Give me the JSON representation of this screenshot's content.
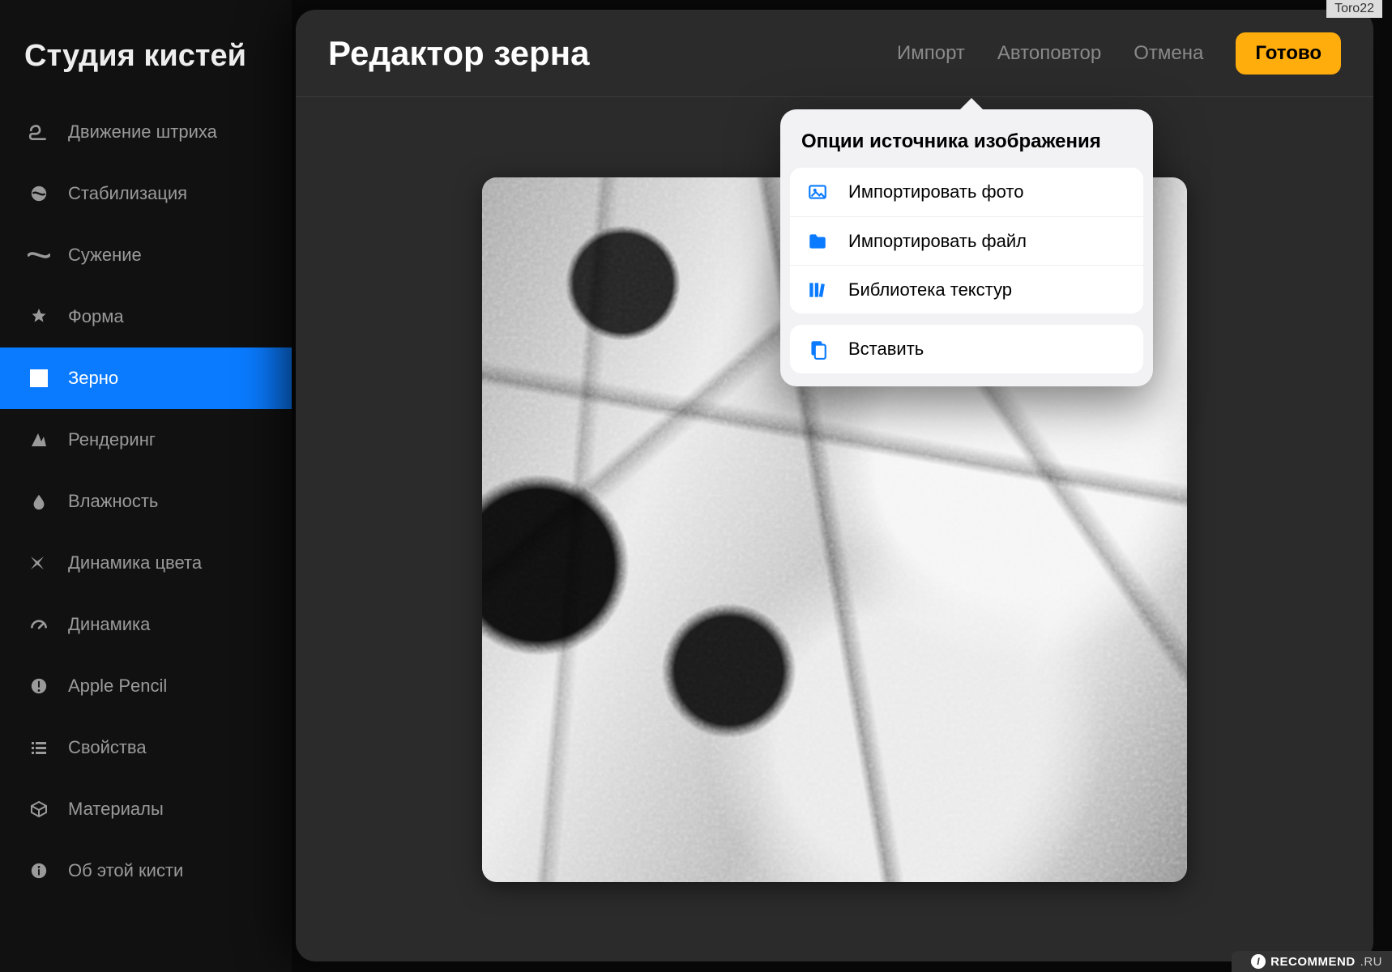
{
  "sidebar": {
    "title": "Студия кистей",
    "items": [
      {
        "label": "Движение штриха",
        "icon": "stroke-path-icon"
      },
      {
        "label": "Стабилизация",
        "icon": "stabilization-icon"
      },
      {
        "label": "Сужение",
        "icon": "taper-icon"
      },
      {
        "label": "Форма",
        "icon": "shape-icon"
      },
      {
        "label": "Зерно",
        "icon": "grain-icon",
        "selected": true
      },
      {
        "label": "Рендеринг",
        "icon": "rendering-icon"
      },
      {
        "label": "Влажность",
        "icon": "wetness-icon"
      },
      {
        "label": "Динамика цвета",
        "icon": "color-dynamics-icon"
      },
      {
        "label": "Динамика",
        "icon": "dynamics-icon"
      },
      {
        "label": "Apple Pencil",
        "icon": "apple-pencil-icon"
      },
      {
        "label": "Свойства",
        "icon": "properties-icon"
      },
      {
        "label": "Материалы",
        "icon": "materials-icon"
      },
      {
        "label": "Об этой кисти",
        "icon": "about-icon"
      }
    ]
  },
  "editor": {
    "title": "Редактор зерна",
    "import_label": "Импорт",
    "autorepeat_label": "Автоповтор",
    "cancel_label": "Отмена",
    "done_label": "Готово"
  },
  "popover": {
    "title": "Опции источника изображения",
    "items": [
      {
        "label": "Импортировать фото",
        "icon": "photo-icon"
      },
      {
        "label": "Импортировать файл",
        "icon": "folder-icon"
      },
      {
        "label": "Библиотека текстур",
        "icon": "library-icon"
      },
      {
        "label": "Вставить",
        "icon": "paste-icon"
      }
    ]
  },
  "watermark": {
    "tag": "Toro22",
    "strip_prefix": "I",
    "strip_main": "RECOMMEND",
    "strip_suffix": ".RU"
  },
  "colors": {
    "accent": "#0a7bff",
    "done_button": "#ffad0d",
    "icon_blue": "#0a7bff"
  }
}
